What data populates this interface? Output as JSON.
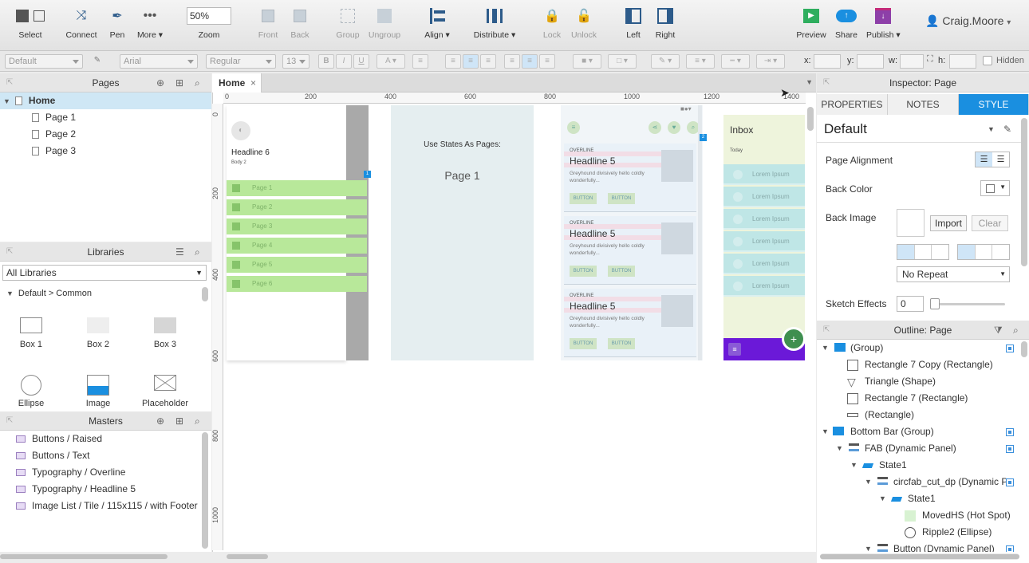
{
  "toolbar": {
    "select": "Select",
    "connect": "Connect",
    "pen": "Pen",
    "more": "More ▾",
    "zoom_value": "50%",
    "zoom_label": "Zoom",
    "front": "Front",
    "back": "Back",
    "group": "Group",
    "ungroup": "Ungroup",
    "align": "Align ▾",
    "distribute": "Distribute ▾",
    "lock": "Lock",
    "unlock": "Unlock",
    "left": "Left",
    "right": "Right",
    "preview": "Preview",
    "share": "Share",
    "publish": "Publish ▾",
    "user": "Craig.Moore"
  },
  "format": {
    "style": "Default",
    "font": "Arial",
    "weight": "Regular",
    "size": "13",
    "x_label": "x:",
    "y_label": "y:",
    "w_label": "w:",
    "h_label": "h:",
    "hidden": "Hidden"
  },
  "pages": {
    "title": "Pages",
    "root": "Home",
    "items": [
      "Page 1",
      "Page 2",
      "Page 3"
    ]
  },
  "libraries": {
    "title": "Libraries",
    "selected": "All Libraries",
    "group": "Default > Common",
    "items": [
      "Box 1",
      "Box 2",
      "Box 3",
      "Ellipse",
      "Image",
      "Placeholder"
    ]
  },
  "masters": {
    "title": "Masters",
    "items": [
      "Buttons / Raised",
      "Buttons / Text",
      "Typography / Overline",
      "Typography / Headline 5",
      "Image List / Tile / 115x115 / with Footer"
    ]
  },
  "canvas": {
    "tab": "Home",
    "ruler_h": [
      "0",
      "200",
      "400",
      "600",
      "800",
      "1000",
      "1200",
      "1400"
    ],
    "ruler_v": [
      "0",
      "200",
      "400",
      "600",
      "800",
      "1000"
    ],
    "frame1": {
      "headline": "Headline 6",
      "body": "Body 2",
      "rows": [
        "Page 1",
        "Page 2",
        "Page 3",
        "Page 4",
        "Page 5",
        "Page 6"
      ]
    },
    "frame2": {
      "caption": "Use States As Pages:",
      "page": "Page 1"
    },
    "frame3": {
      "cards": [
        {
          "overline": "OVERLINE",
          "headline": "Headline 5",
          "body": "Greyhound divisively hello coldly wonderfully...",
          "b1": "BUTTON",
          "b2": "BUTTON"
        },
        {
          "overline": "OVERLINE",
          "headline": "Headline 5",
          "body": "Greyhound divisively hello coldly wonderfully...",
          "b1": "BUTTON",
          "b2": "BUTTON"
        },
        {
          "overline": "OVERLINE",
          "headline": "Headline 5",
          "body": "Greyhound divisively hello coldly wonderfully...",
          "b1": "BUTTON",
          "b2": "BUTTON"
        }
      ]
    },
    "frame4": {
      "title": "Inbox",
      "subtitle": "Today",
      "rows": [
        "Lorem Ipsum",
        "Lorem Ipsum",
        "Lorem Ipsum",
        "Lorem Ipsum",
        "Lorem Ipsum",
        "Lorem Ipsum"
      ]
    }
  },
  "inspector": {
    "title": "Inspector: Page",
    "tabs": [
      "PROPERTIES",
      "NOTES",
      "STYLE"
    ],
    "style_name": "Default",
    "page_alignment": "Page Alignment",
    "back_color": "Back Color",
    "back_image": "Back Image",
    "import": "Import",
    "clear": "Clear",
    "repeat": "No Repeat",
    "sketch_effects": "Sketch Effects",
    "sketch_value": "0"
  },
  "outline": {
    "title": "Outline: Page",
    "rows": [
      "(Group)",
      "Rectangle 7 Copy (Rectangle)",
      "Triangle (Shape)",
      "Rectangle 7 (Rectangle)",
      "(Rectangle)",
      "Bottom Bar (Group)",
      "FAB (Dynamic Panel)",
      "State1",
      "circfab_cut_dp (Dynamic P",
      "State1",
      "MovedHS (Hot Spot)",
      "Ripple2 (Ellipse)",
      "Button (Dynamic Panel)"
    ]
  }
}
